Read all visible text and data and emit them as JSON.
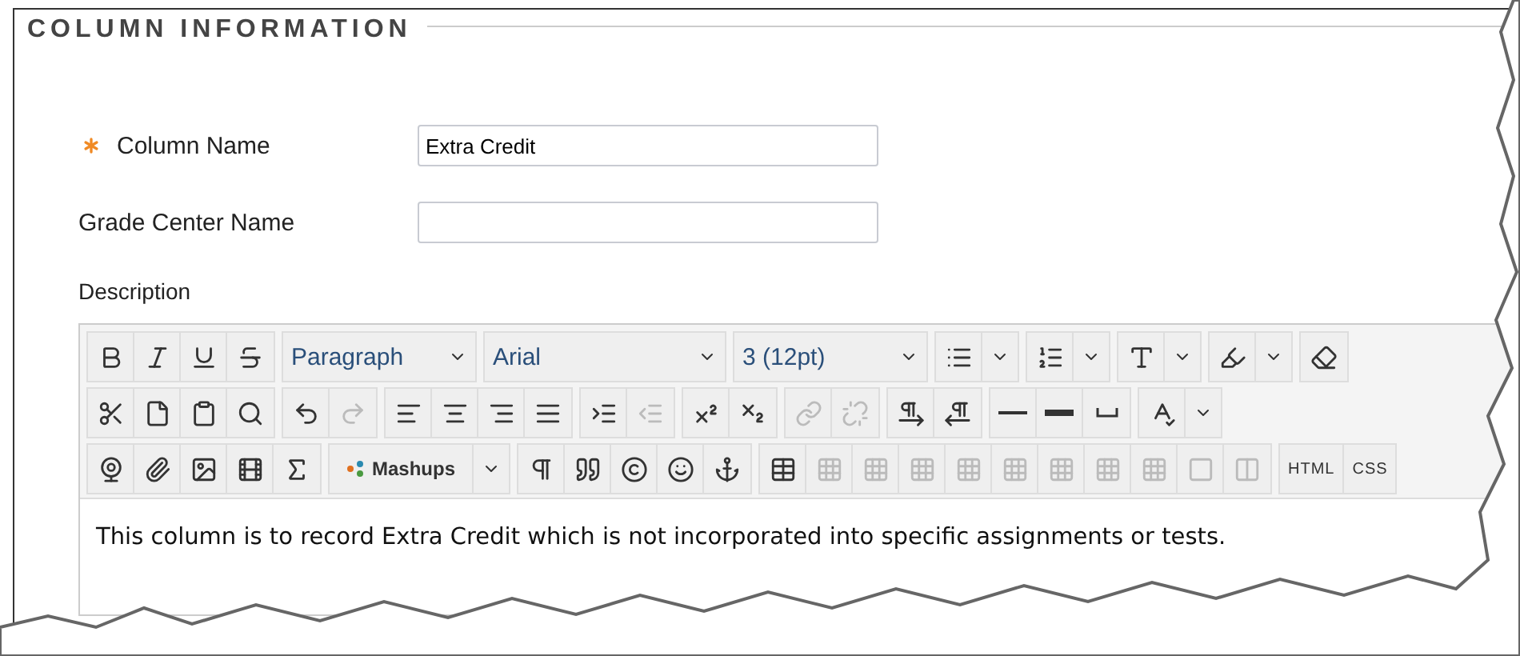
{
  "section": {
    "title": "COLUMN INFORMATION"
  },
  "fields": [
    {
      "label": "Column Name",
      "required": true,
      "value": "Extra Credit"
    },
    {
      "label": "Grade Center Name",
      "required": false
    }
  ],
  "description": {
    "label": "Description",
    "toolbar_rows": [
      [
        [
          {
            "kind": "bold",
            "disabled": false
          },
          {
            "kind": "italic",
            "disabled": false
          },
          {
            "kind": "underline",
            "disabled": false
          },
          {
            "kind": "strike",
            "disabled": false
          }
        ],
        [
          {
            "kind": "select",
            "text": "Paragraph",
            "disabled": false
          }
        ],
        [
          {
            "kind": "select",
            "text": "Arial",
            "disabled": false
          }
        ],
        [
          {
            "kind": "select",
            "text": "3 (12pt)",
            "disabled": false
          }
        ],
        [
          {
            "kind": "bullets",
            "disabled": false
          },
          {
            "kind": "dropdown",
            "disabled": false
          }
        ],
        [
          {
            "kind": "numbers",
            "disabled": false
          },
          {
            "kind": "dropdown",
            "disabled": false
          }
        ],
        [
          {
            "kind": "textcolor",
            "disabled": false
          },
          {
            "kind": "dropdown",
            "disabled": false
          }
        ],
        [
          {
            "kind": "highlight",
            "disabled": false
          },
          {
            "kind": "dropdown",
            "disabled": false
          }
        ],
        [
          {
            "kind": "eraser",
            "disabled": false
          }
        ]
      ],
      [
        [
          {
            "kind": "cut",
            "disabled": false
          },
          {
            "kind": "copy",
            "disabled": false
          },
          {
            "kind": "paste",
            "disabled": false
          },
          {
            "kind": "find",
            "disabled": false
          }
        ],
        [
          {
            "kind": "undo",
            "disabled": false
          },
          {
            "kind": "redo",
            "disabled": true
          }
        ],
        [
          {
            "kind": "alignleft",
            "disabled": false
          },
          {
            "kind": "aligncenter",
            "disabled": false
          },
          {
            "kind": "alignright",
            "disabled": false
          },
          {
            "kind": "justify",
            "disabled": false
          }
        ],
        [
          {
            "kind": "indent",
            "disabled": false
          },
          {
            "kind": "outdent",
            "disabled": true
          }
        ],
        [
          {
            "kind": "superscript",
            "disabled": false
          },
          {
            "kind": "subscript",
            "disabled": false
          }
        ],
        [
          {
            "kind": "link",
            "disabled": true
          },
          {
            "kind": "unlink",
            "disabled": true
          }
        ],
        [
          {
            "kind": "ltr",
            "disabled": false
          },
          {
            "kind": "rtl",
            "disabled": false
          }
        ],
        [
          {
            "kind": "rule",
            "disabled": false
          },
          {
            "kind": "thickrule",
            "disabled": false
          },
          {
            "kind": "space",
            "disabled": false
          }
        ],
        [
          {
            "kind": "spellcheck",
            "disabled": false
          },
          {
            "kind": "dropdown",
            "disabled": false
          }
        ]
      ],
      [
        [
          {
            "kind": "webcam",
            "disabled": false
          },
          {
            "kind": "attach",
            "disabled": false
          },
          {
            "kind": "image",
            "disabled": false
          },
          {
            "kind": "media",
            "disabled": false
          },
          {
            "kind": "math",
            "disabled": false
          }
        ],
        [
          {
            "kind": "mashups",
            "text": "Mashups",
            "disabled": false
          },
          {
            "kind": "dropdown",
            "disabled": false
          }
        ],
        [
          {
            "kind": "pilcrow",
            "disabled": false
          },
          {
            "kind": "quote",
            "disabled": false
          },
          {
            "kind": "copyright",
            "disabled": false
          },
          {
            "kind": "emoji",
            "disabled": false
          },
          {
            "kind": "anchor",
            "disabled": false
          }
        ],
        [
          {
            "kind": "table",
            "disabled": false
          },
          {
            "kind": "tablecell",
            "disabled": true
          },
          {
            "kind": "tablecell",
            "disabled": true
          },
          {
            "kind": "tablecell",
            "disabled": true
          },
          {
            "kind": "tablecell",
            "disabled": true
          },
          {
            "kind": "tablecell",
            "disabled": true
          },
          {
            "kind": "tablecell",
            "disabled": true
          },
          {
            "kind": "tablecell",
            "disabled": true
          },
          {
            "kind": "tablecell",
            "disabled": true
          },
          {
            "kind": "square",
            "disabled": true
          },
          {
            "kind": "columns",
            "disabled": true
          }
        ],
        [
          {
            "kind": "text",
            "text": "HTML",
            "disabled": false
          },
          {
            "kind": "text",
            "text": "CSS",
            "disabled": false
          }
        ]
      ]
    ],
    "body": "This column is to record Extra Credit which is not incorporated into specific assignments or tests."
  }
}
